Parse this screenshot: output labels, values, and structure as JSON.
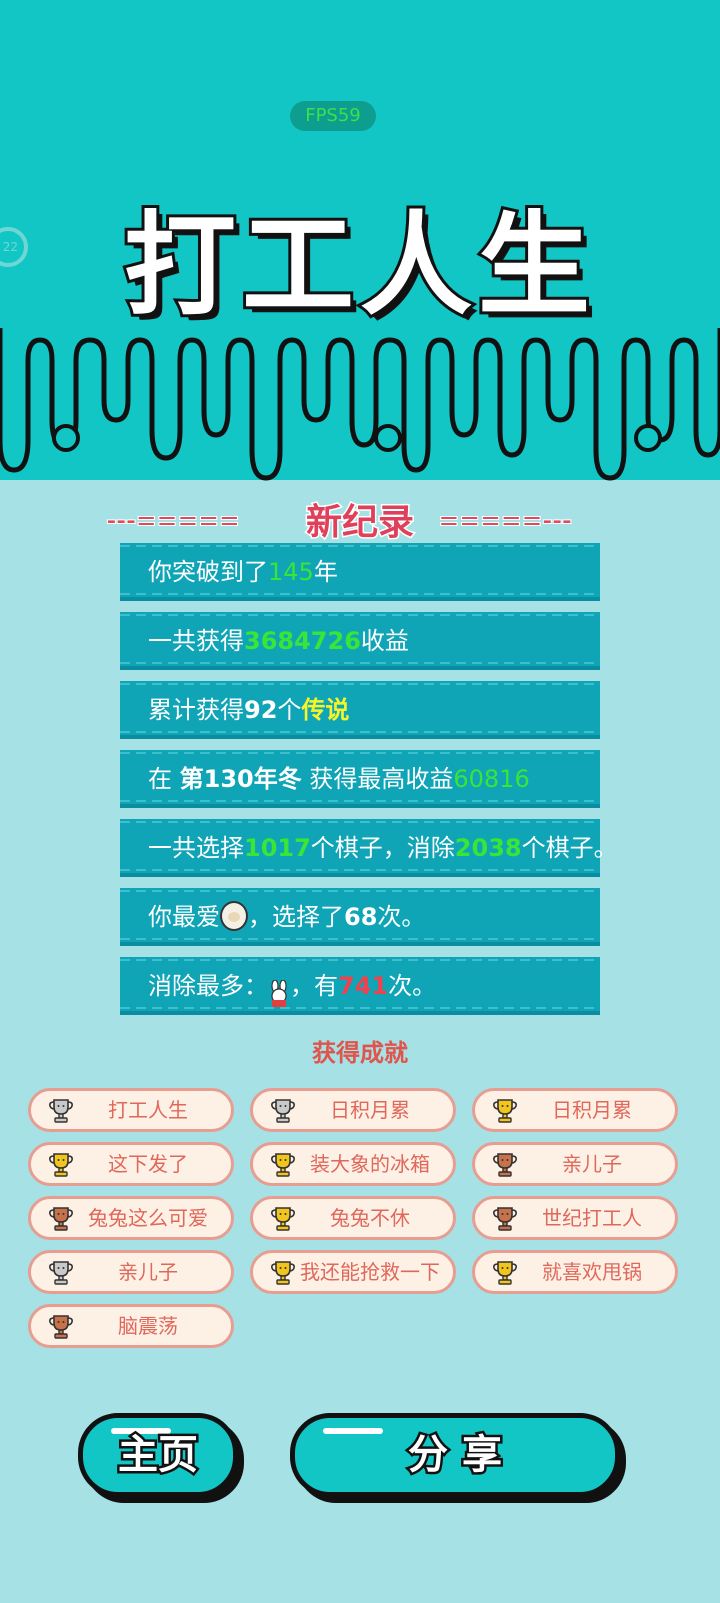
{
  "hud": {
    "fps": "FPS59",
    "side_counter": "22"
  },
  "title": "打工人生",
  "record": {
    "label": "新纪录",
    "dash_left": "---=====",
    "dash_right": "=====---"
  },
  "stats": {
    "years": {
      "pre": "你突破到了",
      "value": "145",
      "post": "年"
    },
    "income": {
      "pre": "一共获得",
      "value": "3684726",
      "post": "收益"
    },
    "legend": {
      "pre": "累计获得",
      "value": "92",
      "mid": "个",
      "tag": "传说"
    },
    "best": {
      "pre": "在 ",
      "season": "第130年冬",
      "mid": " 获得最高收益",
      "value": "60816"
    },
    "pieces": {
      "pre": "一共选择",
      "chosen": "1017",
      "mid": "个棋子，消除",
      "removed": "2038",
      "post": "个棋子。"
    },
    "favorite": {
      "pre": "你最爱",
      "mid": "，选择了",
      "value": "68",
      "post": "次。"
    },
    "most_removed": {
      "pre": "消除最多：",
      "mid": "，有",
      "value": "741",
      "post": "次。"
    }
  },
  "achievements": {
    "title": "获得成就",
    "items": [
      {
        "label": "打工人生",
        "tier": "silver"
      },
      {
        "label": "日积月累",
        "tier": "silver"
      },
      {
        "label": "日积月累",
        "tier": "gold"
      },
      {
        "label": "这下发了",
        "tier": "gold"
      },
      {
        "label": "装大象的冰箱",
        "tier": "gold"
      },
      {
        "label": "亲儿子",
        "tier": "bronze"
      },
      {
        "label": "兔兔这么可爱",
        "tier": "bronze"
      },
      {
        "label": "兔兔不休",
        "tier": "gold"
      },
      {
        "label": "世纪打工人",
        "tier": "bronze"
      },
      {
        "label": "亲儿子",
        "tier": "silver"
      },
      {
        "label": "我还能抢救一下",
        "tier": "gold"
      },
      {
        "label": "就喜欢甩锅",
        "tier": "gold"
      },
      {
        "label": "脑震荡",
        "tier": "bronze"
      }
    ]
  },
  "buttons": {
    "home": "主页",
    "share": "分 享"
  },
  "colors": {
    "teal": "#13c6c6",
    "bg": "#a6e1e6",
    "row": "#0fa5b6",
    "green": "#39e536",
    "yellow": "#f4f52a",
    "red": "#f0414f",
    "gold": "#f2c51d",
    "silver": "#c9c9c9",
    "bronze": "#c8724a"
  }
}
